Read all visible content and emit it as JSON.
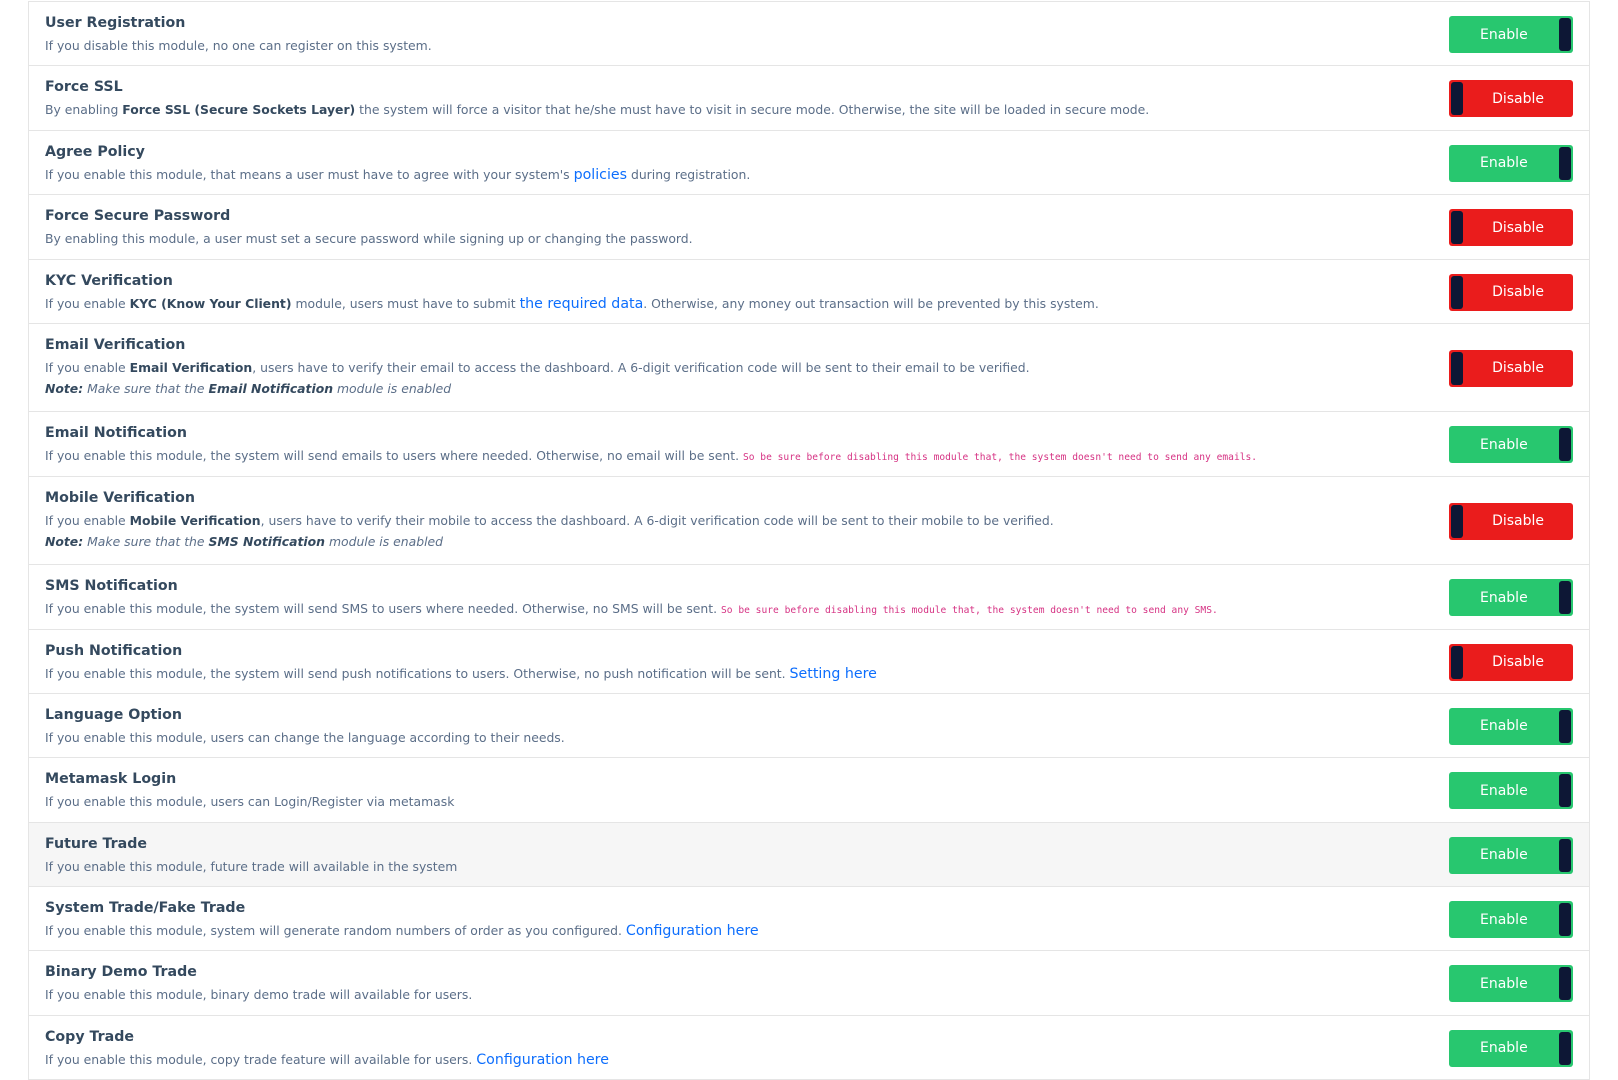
{
  "colors": {
    "enable": "#28c76f",
    "disable": "#ea1c1c",
    "knob": "#0d1735",
    "link": "#0d6efd",
    "code": "#d63384"
  },
  "modules": [
    {
      "title": "User Registration",
      "state": "Enable",
      "desc": {
        "pre": "If you disable this module, no one can register on this system."
      }
    },
    {
      "title": "Force SSL",
      "state": "Disable",
      "desc": {
        "pre": "By enabling ",
        "bold": "Force SSL (Secure Sockets Layer)",
        "post": " the system will force a visitor that he/she must have to visit in secure mode. Otherwise, the site will be loaded in secure mode."
      }
    },
    {
      "title": "Agree Policy",
      "state": "Enable",
      "desc": {
        "pre": "If you enable this module, that means a user must have to agree with your system's ",
        "link": "policies",
        "post": " during registration."
      }
    },
    {
      "title": "Force Secure Password",
      "state": "Disable",
      "desc": {
        "pre": "By enabling this module, a user must set a secure password while signing up or changing the password."
      }
    },
    {
      "title": "KYC Verification",
      "state": "Disable",
      "desc": {
        "pre": "If you enable ",
        "bold": "KYC (Know Your Client)",
        "mid": " module, users must have to submit ",
        "link": "the required data",
        "post": ". Otherwise, any money out transaction will be prevented by this system."
      }
    },
    {
      "title": "Email Verification",
      "state": "Disable",
      "desc": {
        "pre": "If you enable ",
        "bold": "Email Verification",
        "post": ", users have to verify their email to access the dashboard. A 6-digit verification code will be sent to their email to be verified."
      },
      "note": {
        "label": "Note:",
        "pre": " Make sure that the ",
        "bold": "Email Notification",
        "post": " module is enabled"
      }
    },
    {
      "title": "Email Notification",
      "state": "Enable",
      "desc": {
        "pre": "If you enable this module, the system will send emails to users where needed. Otherwise, no email will be sent. ",
        "code": "So be sure before disabling this module that, the system doesn't need to send any emails."
      }
    },
    {
      "title": "Mobile Verification",
      "state": "Disable",
      "desc": {
        "pre": "If you enable ",
        "bold": "Mobile Verification",
        "post": ", users have to verify their mobile to access the dashboard. A 6-digit verification code will be sent to their mobile to be verified."
      },
      "note": {
        "label": "Note:",
        "pre": " Make sure that the ",
        "bold": "SMS Notification",
        "post": " module is enabled"
      }
    },
    {
      "title": "SMS Notification",
      "state": "Enable",
      "desc": {
        "pre": "If you enable this module, the system will send SMS to users where needed. Otherwise, no SMS will be sent. ",
        "code": "So be sure before disabling this module that, the system doesn't need to send any SMS."
      }
    },
    {
      "title": "Push Notification",
      "state": "Disable",
      "desc": {
        "pre": "If you enable this module, the system will send push notifications to users. Otherwise, no push notification will be sent. ",
        "link": "Setting here"
      }
    },
    {
      "title": "Language Option",
      "state": "Enable",
      "desc": {
        "pre": "If you enable this module, users can change the language according to their needs."
      }
    },
    {
      "title": "Metamask Login",
      "state": "Enable",
      "desc": {
        "pre": "If you enable this module, users can Login/Register via metamask"
      }
    },
    {
      "title": "Future Trade",
      "state": "Enable",
      "highlighted": true,
      "desc": {
        "pre": "If you enable this module, future trade will available in the system"
      }
    },
    {
      "title": "System Trade/Fake Trade",
      "state": "Enable",
      "desc": {
        "pre": "If you enable this module, system will generate random numbers of order as you configured. ",
        "link": "Configuration here"
      }
    },
    {
      "title": "Binary Demo Trade",
      "state": "Enable",
      "desc": {
        "pre": "If you enable this module, binary demo trade will available for users."
      }
    },
    {
      "title": "Copy Trade",
      "state": "Enable",
      "desc": {
        "pre": "If you enable this module, copy trade feature will available for users. ",
        "link": "Configuration here"
      }
    }
  ]
}
